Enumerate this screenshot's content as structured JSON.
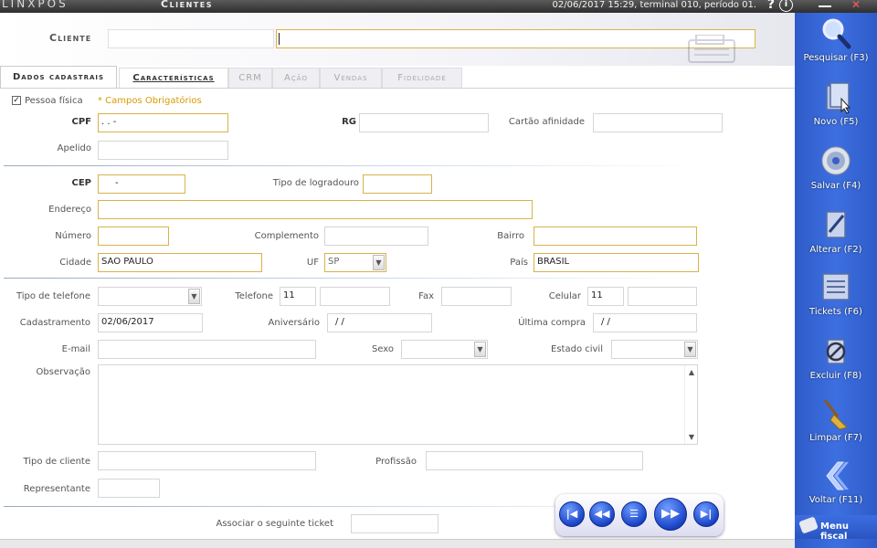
{
  "titlebar": {
    "logo": "LINXPOS",
    "title": "Clientes",
    "status": "02/06/2017 15:29, terminal 010, período 01."
  },
  "header": {
    "cliente_label": "Cliente",
    "cliente_code": "",
    "cliente_name": ""
  },
  "tabs": [
    {
      "label": "Dados cadastrais"
    },
    {
      "label": "Características"
    },
    {
      "label": "CRM"
    },
    {
      "label": "Ação"
    },
    {
      "label": "Vendas"
    },
    {
      "label": "Fidelidade"
    }
  ],
  "form": {
    "pessoa_fisica_label": "Pessoa física",
    "pessoa_fisica_checked": true,
    "required_note": "* Campos Obrigatórios",
    "cpf_label": "CPF",
    "cpf_value": "  .   .   -",
    "rg_label": "RG",
    "rg_value": "",
    "cartao_label": "Cartão afinidade",
    "cartao_value": "",
    "apelido_label": "Apelido",
    "apelido_value": "",
    "cep_label": "CEP",
    "cep_value": "     -",
    "tipo_logradouro_label": "Tipo de logradouro",
    "tipo_logradouro_value": "",
    "endereco_label": "Endereço",
    "endereco_value": "",
    "numero_label": "Número",
    "numero_value": "",
    "complemento_label": "Complemento",
    "complemento_value": "",
    "bairro_label": "Bairro",
    "bairro_value": "",
    "cidade_label": "Cidade",
    "cidade_value": "SAO PAULO",
    "uf_label": "UF",
    "uf_value": "SP",
    "pais_label": "País",
    "pais_value": "BRASIL",
    "tipo_telefone_label": "Tipo de telefone",
    "tipo_telefone_value": "",
    "telefone_label": "Telefone",
    "telefone_ddd": "11",
    "telefone_value": "",
    "fax_label": "Fax",
    "fax_value": "",
    "celular_label": "Celular",
    "celular_ddd": "11",
    "celular_value": "",
    "cadastramento_label": "Cadastramento",
    "cadastramento_value": "02/06/2017",
    "aniversario_label": "Aniversário",
    "aniversario_value": " / /",
    "ultima_compra_label": "Última compra",
    "ultima_compra_value": " / /",
    "email_label": "E-mail",
    "email_value": "",
    "sexo_label": "Sexo",
    "sexo_value": "",
    "estado_civil_label": "Estado civil",
    "estado_civil_value": "",
    "observacao_label": "Observação",
    "observacao_value": "",
    "tipo_cliente_label": "Tipo de cliente",
    "tipo_cliente_value": "",
    "profissao_label": "Profissão",
    "profissao_value": "",
    "representante_label": "Representante",
    "representante_value": "",
    "ticket_label": "Associar o seguinte ticket",
    "ticket_value": ""
  },
  "sidebar": {
    "buttons": [
      {
        "label": "Pesquisar (F3)",
        "icon": "magnifier-icon"
      },
      {
        "label": "Novo (F5)",
        "icon": "new-document-icon"
      },
      {
        "label": "Salvar (F4)",
        "icon": "disc-icon"
      },
      {
        "label": "Alterar (F2)",
        "icon": "edit-document-icon"
      },
      {
        "label": "Tickets (F6)",
        "icon": "tickets-icon"
      },
      {
        "label": "Excluir (F8)",
        "icon": "delete-icon"
      },
      {
        "label": "Limpar (F7)",
        "icon": "broom-icon"
      },
      {
        "label": "Voltar (F11)",
        "icon": "back-chevron-icon"
      }
    ],
    "menu_fiscal": "Menu fiscal"
  },
  "nav": {
    "first": "first-record-icon",
    "prev": "previous-record-icon",
    "list": "list-icon",
    "next": "next-record-icon",
    "last": "last-record-icon"
  },
  "colors": {
    "sidebar_blue": "#3d6fe0",
    "required_border": "#d8b24a",
    "required_note": "#d99a00"
  }
}
